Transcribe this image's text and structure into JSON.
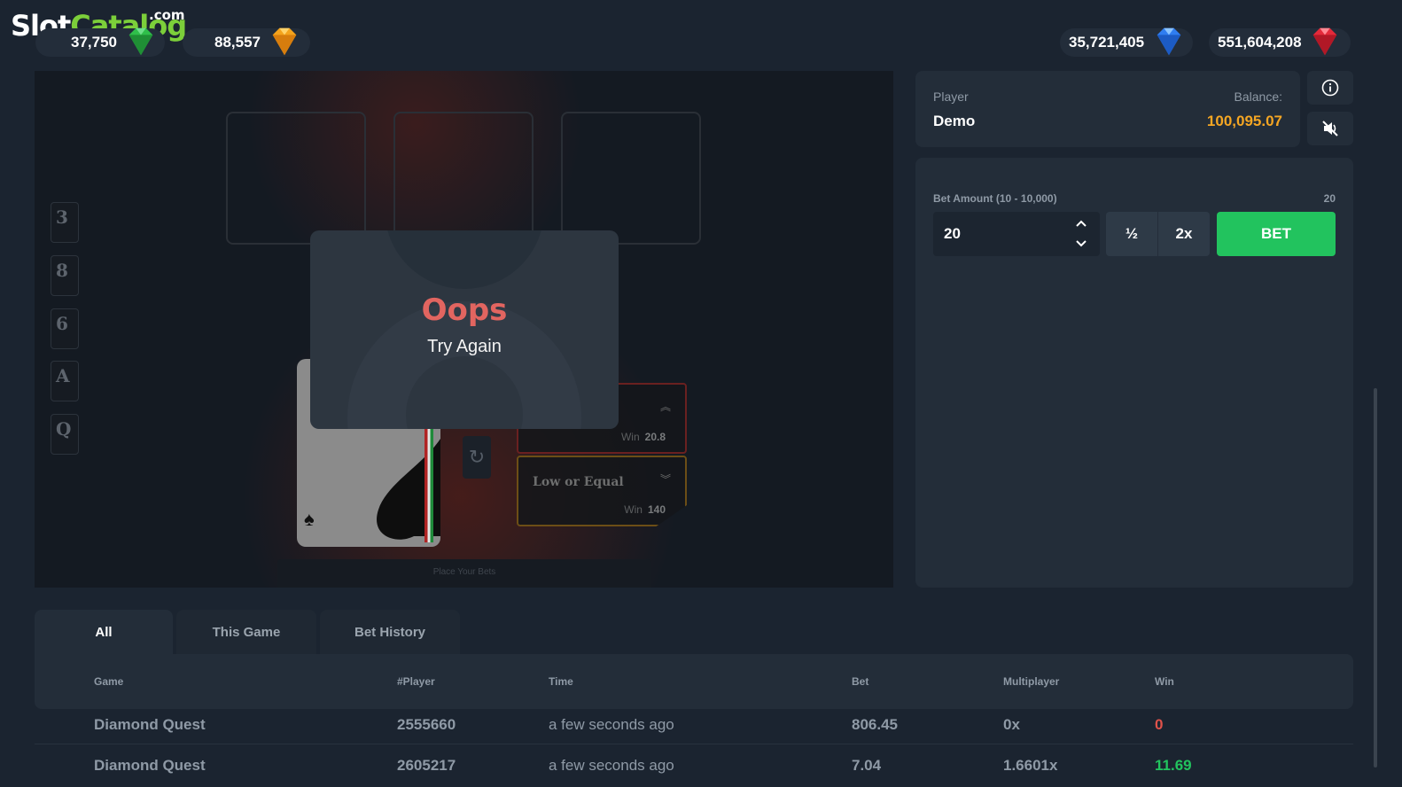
{
  "logo": {
    "slot": "Slot",
    "catalog": "Catalog",
    "dotcom": ".com"
  },
  "jackpots": [
    {
      "value": "37,750",
      "gem": "green-gem",
      "color": "#2fbf4a"
    },
    {
      "value": "88,557",
      "gem": "orange-gem",
      "color": "#f4a31c"
    },
    {
      "value": "35,721,405",
      "gem": "blue-gem",
      "color": "#2f7df0"
    },
    {
      "value": "551,604,208",
      "gem": "red-gem",
      "color": "#e42a3a"
    }
  ],
  "game": {
    "history_cards": [
      "3",
      "8",
      "6",
      "A",
      "Q"
    ],
    "high_bet": {
      "win_label": "Win",
      "win_value": "20.8"
    },
    "low_bet": {
      "title": "Low or Equal",
      "win_label": "Win",
      "win_value": "140"
    },
    "place_bets": "Place Your Bets",
    "popup": {
      "title": "Oops",
      "subtitle": "Try Again"
    }
  },
  "player": {
    "player_label": "Player",
    "player_name": "Demo",
    "balance_label": "Balance:",
    "balance_value": "100,095.07",
    "balance_color": "#f5a623"
  },
  "bet": {
    "label": "Bet Amount (10 - 10,000)",
    "current_label": "20",
    "amount": "20",
    "half": "½",
    "double": "2x",
    "bet_button": "BET",
    "accent": "#22c35e"
  },
  "tabs": [
    "All",
    "This Game",
    "Bet History"
  ],
  "table": {
    "headers": [
      "Game",
      "#Player",
      "Time",
      "Bet",
      "Multiplayer",
      "Win"
    ],
    "rows": [
      [
        "Diamond Quest",
        "2555660",
        "a few seconds ago",
        "806.45",
        "0x",
        "0"
      ],
      [
        "Diamond Quest",
        "2605217",
        "a few seconds ago",
        "7.04",
        "1.6601x",
        "11.69"
      ]
    ],
    "loss_color": "#e0524a",
    "win_color": "#22c35e"
  }
}
